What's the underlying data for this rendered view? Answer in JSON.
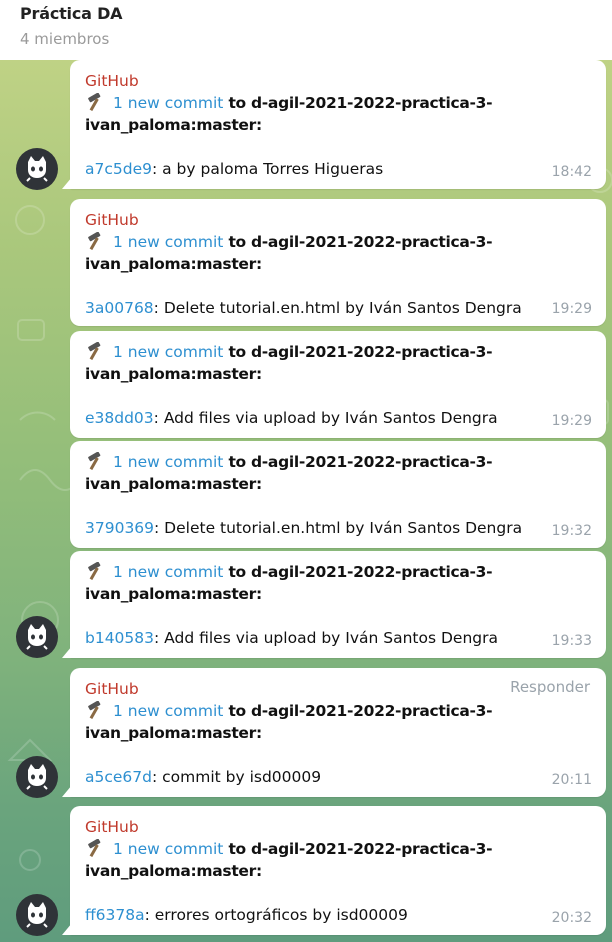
{
  "header": {
    "title": "Práctica DA",
    "subtitle": "4 miembros"
  },
  "colors": {
    "sender": "#c0392b",
    "link": "#2d8fd0",
    "time": "#9aa3ab"
  },
  "messages": [
    {
      "sender": "GitHub",
      "hammer": "hammer-icon",
      "link_text": "1 new commit",
      "to_text": " to ",
      "repo_line1": "d-agil-2021-2022-practica-3-",
      "repo_line2": "ivan_paloma:master:",
      "hash": "a7c5de9",
      "text": ": a by paloma Torres Higueras",
      "time": "18:42"
    },
    {
      "sender": "GitHub",
      "hammer": "hammer-icon",
      "link_text": "1 new commit",
      "to_text": " to ",
      "repo_line1": "d-agil-2021-2022-practica-3-",
      "repo_line2": "ivan_paloma:master:",
      "hash": "3a00768",
      "text": ": Delete tutorial.en.html by Iván Santos Dengra",
      "time": "19:29"
    },
    {
      "sender": "",
      "hammer": "hammer-icon",
      "link_text": "1 new commit",
      "to_text": " to ",
      "repo_line1": "d-agil-2021-2022-practica-3-",
      "repo_line2": "ivan_paloma:master:",
      "hash": "e38dd03",
      "text": ": Add files via upload by Iván Santos Dengra",
      "time": "19:29"
    },
    {
      "sender": "",
      "hammer": "hammer-icon",
      "link_text": "1 new commit",
      "to_text": " to ",
      "repo_line1": "d-agil-2021-2022-practica-3-",
      "repo_line2": "ivan_paloma:master:",
      "hash": "3790369",
      "text": ": Delete tutorial.en.html by Iván Santos Dengra",
      "time": "19:32"
    },
    {
      "sender": "",
      "hammer": "hammer-icon",
      "link_text": "1 new commit",
      "to_text": " to ",
      "repo_line1": "d-agil-2021-2022-practica-3-",
      "repo_line2": "ivan_paloma:master:",
      "hash": "b140583",
      "text": ": Add files via upload by Iván Santos Dengra",
      "time": "19:33"
    },
    {
      "sender": "GitHub",
      "reply": "Responder",
      "hammer": "hammer-icon",
      "link_text": "1 new commit",
      "to_text": " to ",
      "repo_line1": "d-agil-2021-2022-practica-3-",
      "repo_line2": "ivan_paloma:master:",
      "hash": "a5ce67d",
      "text": ": commit by isd00009",
      "time": "20:11"
    },
    {
      "sender": "GitHub",
      "hammer": "hammer-icon",
      "link_text": "1 new commit",
      "to_text": " to ",
      "repo_line1": "d-agil-2021-2022-practica-3-",
      "repo_line2": "ivan_paloma:master:",
      "hash": "ff6378a",
      "text": ": errores ortográficos by isd00009",
      "time": "20:32"
    }
  ],
  "avatar_icon": "github-octocat-avatar"
}
